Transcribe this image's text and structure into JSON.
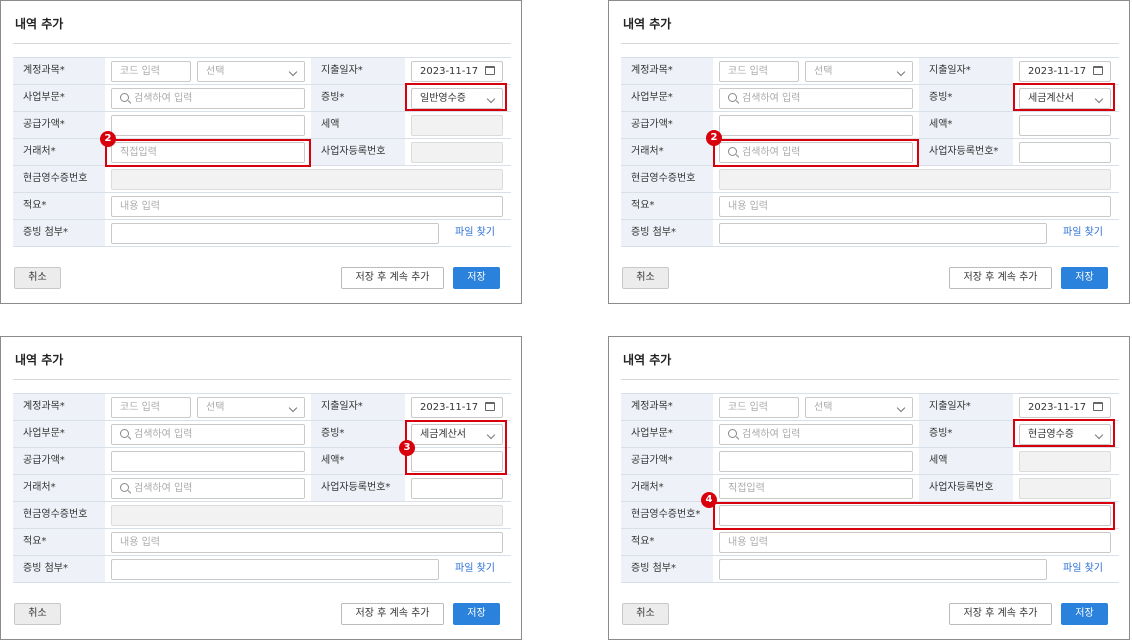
{
  "labels": {
    "title": "내역 추가",
    "account": "계정과목*",
    "date": "지출일자*",
    "division": "사업부문*",
    "evidence": "증빙*",
    "supply": "공급가액*",
    "tax": "세액",
    "tax_req": "세액*",
    "vendor": "거래처*",
    "bizno": "사업자등록번호",
    "bizno_req": "사업자등록번호*",
    "cashno": "현금영수증번호",
    "cashno_req": "현금영수증번호*",
    "memo": "적요*",
    "attach": "증빙 첨부*"
  },
  "placeholders": {
    "code": "코드 입력",
    "select": "선택",
    "search": "검색하여 입력",
    "direct": "직접입력",
    "memo": "내용 입력"
  },
  "values": {
    "date": "2023-11-17"
  },
  "buttons": {
    "find_file": "파일 찾기",
    "cancel": "취소",
    "save_continue": "저장 후 계속 추가",
    "save": "저장"
  },
  "panels": [
    {
      "evidence": "일반영수증",
      "badge": "2"
    },
    {
      "evidence": "세금계산서",
      "badge": "2"
    },
    {
      "evidence": "세금계산서",
      "badge": "3"
    },
    {
      "evidence": "현금영수증",
      "badge": "4"
    }
  ],
  "colors": {
    "highlight": "#d9000d",
    "primary": "#2a82dd",
    "label_bg": "#eef2f8"
  }
}
